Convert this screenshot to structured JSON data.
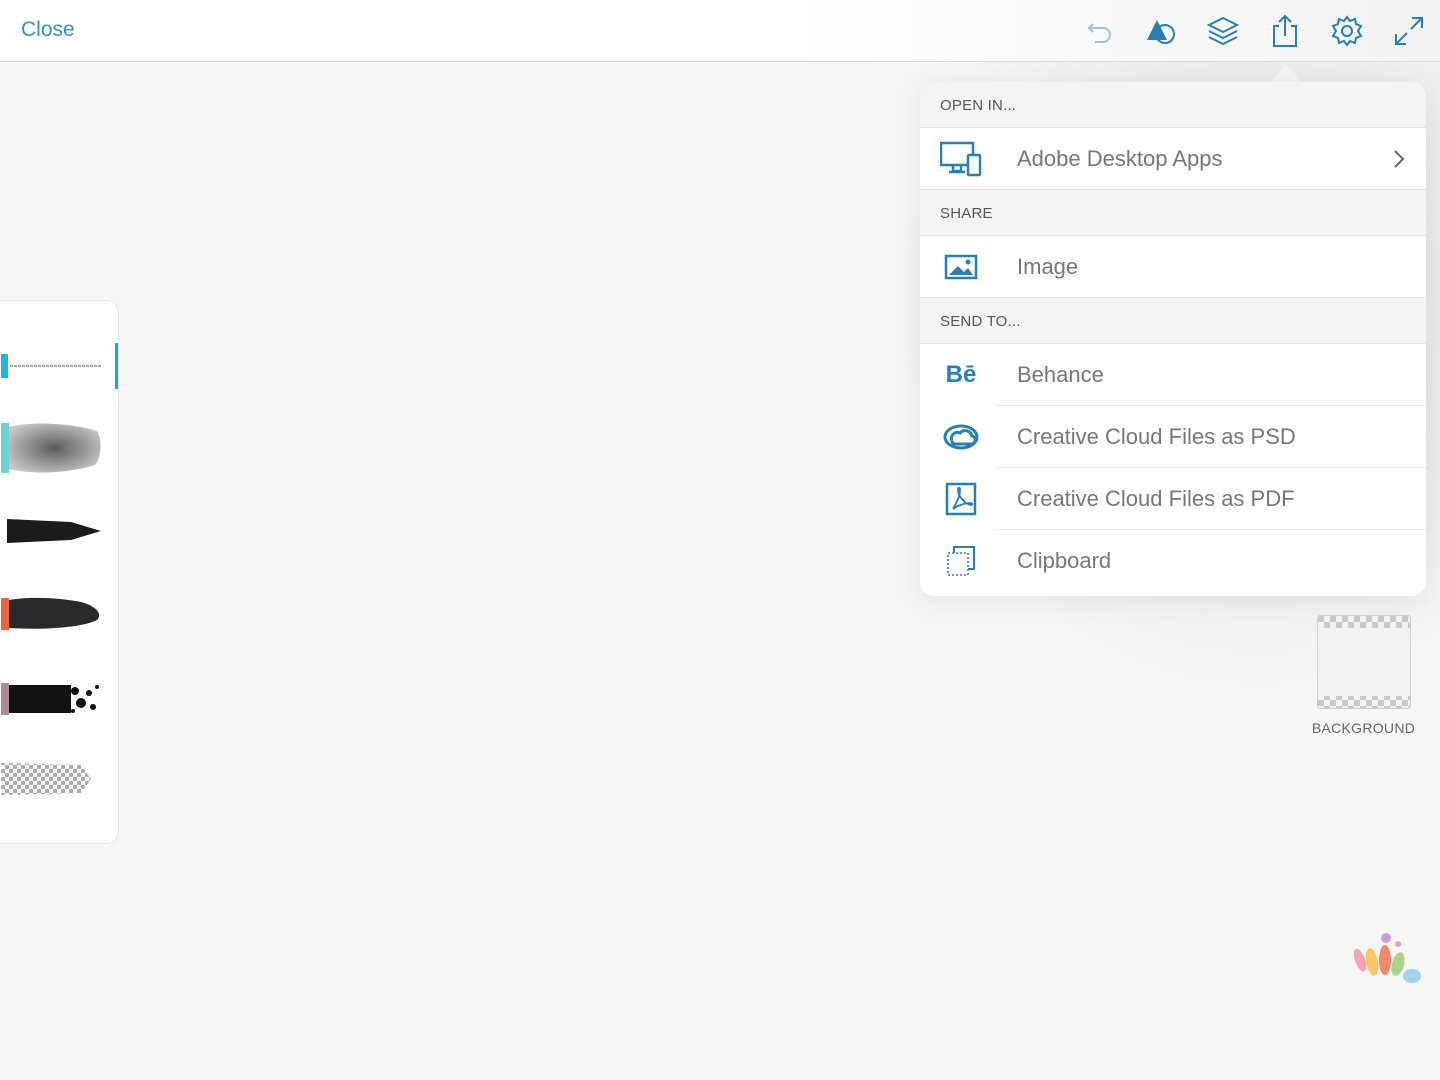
{
  "topbar": {
    "close_label": "Close",
    "tools": [
      "undo-icon",
      "shapes-icon",
      "layers-icon",
      "share-icon",
      "settings-icon",
      "expand-icon"
    ]
  },
  "popover": {
    "open_in": {
      "header": "OPEN IN...",
      "items": [
        {
          "label": "Adobe Desktop Apps",
          "icon": "desktop-devices-icon",
          "has_chevron": true
        }
      ]
    },
    "share": {
      "header": "SHARE",
      "items": [
        {
          "label": "Image",
          "icon": "image-icon"
        }
      ]
    },
    "send_to": {
      "header": "SEND TO...",
      "items": [
        {
          "label": "Behance",
          "icon": "behance-icon"
        },
        {
          "label": "Creative Cloud Files as PSD",
          "icon": "creative-cloud-icon"
        },
        {
          "label": "Creative Cloud Files as PDF",
          "icon": "pdf-icon"
        },
        {
          "label": "Clipboard",
          "icon": "clipboard-icon"
        }
      ]
    }
  },
  "brushes": [
    {
      "name": "fine-pen",
      "swatch": "#1ab6e6",
      "selected": true
    },
    {
      "name": "soft-wash",
      "swatch": "#6fd3d6"
    },
    {
      "name": "marker",
      "swatch": "#222222"
    },
    {
      "name": "dry-brush",
      "swatch": "#f0623d"
    },
    {
      "name": "splatter",
      "swatch": "#b08a92"
    },
    {
      "name": "eraser",
      "swatch": "#cccccc"
    }
  ],
  "layers": {
    "background_label": "BACKGROUND"
  },
  "colors": {
    "accent": "#3a8fbf",
    "icon_blue": "#2a7fb0"
  }
}
